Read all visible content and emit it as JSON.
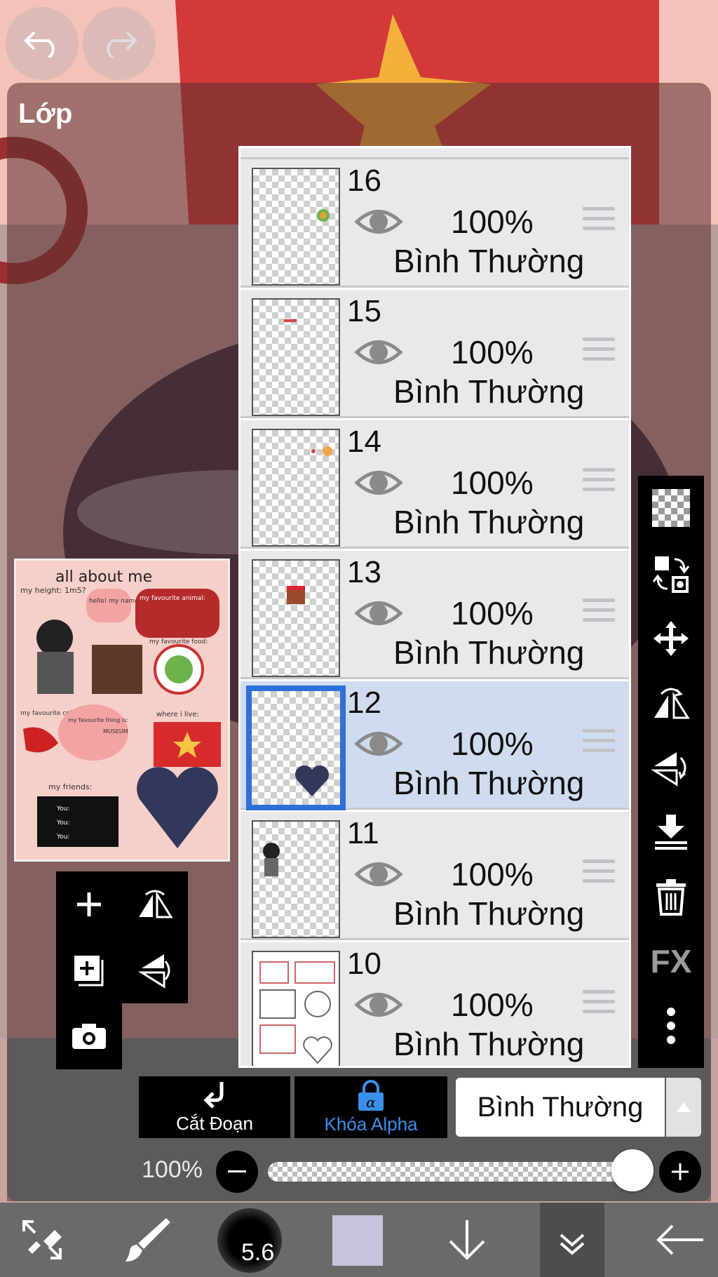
{
  "panel": {
    "title": "Lớp"
  },
  "layers": [
    {
      "number": "16",
      "opacity": "100%",
      "blend": "Bình Thường",
      "selected": false
    },
    {
      "number": "15",
      "opacity": "100%",
      "blend": "Bình Thường",
      "selected": false
    },
    {
      "number": "14",
      "opacity": "100%",
      "blend": "Bình Thường",
      "selected": false
    },
    {
      "number": "13",
      "opacity": "100%",
      "blend": "Bình Thường",
      "selected": false
    },
    {
      "number": "12",
      "opacity": "100%",
      "blend": "Bình Thường",
      "selected": true
    },
    {
      "number": "11",
      "opacity": "100%",
      "blend": "Bình Thường",
      "selected": false
    },
    {
      "number": "10",
      "opacity": "100%",
      "blend": "Bình Thường",
      "selected": false
    }
  ],
  "controls": {
    "clipping_label": "Cắt Đoạn",
    "alpha_lock_label": "Khóa Alpha",
    "blend_mode": "Bình Thường",
    "opacity_label": "100%",
    "opacity_value": 1.0
  },
  "toolbar": {
    "brush_size": "5.6",
    "current_color": "#c6c3dc"
  },
  "right_toolbar": {
    "fx_label": "FX"
  },
  "preview": {
    "title": "all about me",
    "labels": {
      "height": "my height: 1m5?",
      "hello": "hello! my name is:",
      "animal": "my favourite animal:",
      "food": "my favourite food:",
      "colour": "my favourite colour:",
      "thing": "my favourite thing is:",
      "museum": "MUSEUM",
      "live": "where i live:",
      "friends": "my friends:",
      "you": "You:"
    }
  },
  "colors": {
    "accent": "#2f6fd8",
    "alpha_lock": "#3a8fe8",
    "selected_row": "#cfdcef"
  },
  "icons": [
    "undo-icon",
    "redo-icon",
    "eye-icon",
    "drag-handle-icon",
    "transparency-icon",
    "transfer-icon",
    "move-icon",
    "flip-horizontal-icon",
    "flip-vertical-icon",
    "merge-down-icon",
    "trash-icon",
    "more-icon",
    "plus-icon",
    "duplicate-icon",
    "camera-icon",
    "clipping-icon",
    "lock-icon",
    "chevron-up-icon",
    "minus-icon",
    "transform-tool-icon",
    "brush-icon",
    "arrow-down-icon",
    "double-chevron-icon",
    "back-arrow-icon"
  ]
}
